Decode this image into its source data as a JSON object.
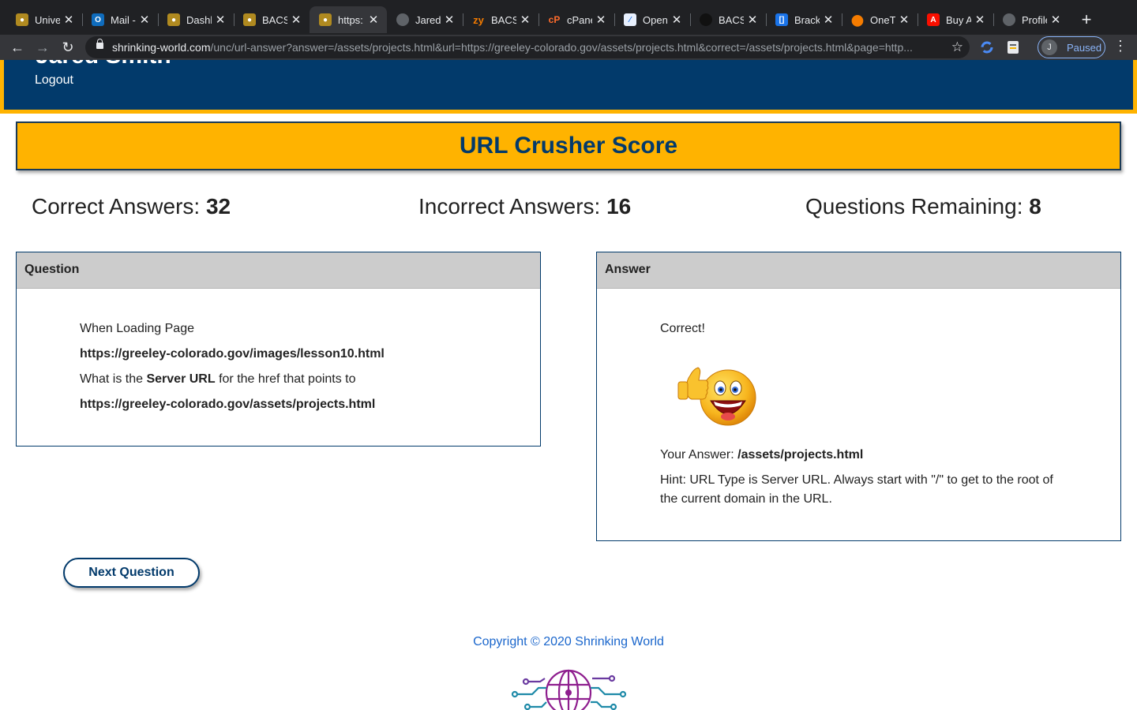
{
  "browser": {
    "tabs": [
      {
        "title": "University",
        "icon": "unc-bear-icon"
      },
      {
        "title": "Mail - ",
        "icon": "outlook-icon"
      },
      {
        "title": "Dashboard",
        "icon": "unc-bear-icon"
      },
      {
        "title": "BACS",
        "icon": "unc-bear-icon"
      },
      {
        "title": "https://",
        "icon": "unc-bear-icon",
        "active": true
      },
      {
        "title": "Jared",
        "icon": "globe-icon"
      },
      {
        "title": "BACS",
        "icon": "zybooks-icon"
      },
      {
        "title": "cPanel",
        "icon": "cpanel-icon"
      },
      {
        "title": "Open",
        "icon": "chart-icon"
      },
      {
        "title": "BACS",
        "icon": "github-icon"
      },
      {
        "title": "Brackets",
        "icon": "brackets-icon"
      },
      {
        "title": "OneTrust",
        "icon": "pin-icon"
      },
      {
        "title": "Buy Adobe",
        "icon": "adobe-icon"
      },
      {
        "title": "Profile",
        "icon": "globe-icon"
      }
    ],
    "url_domain": "shrinking-world.com",
    "url_path": "/unc/url-answer?answer=/assets/projects.html&url=https://greeley-colorado.gov/assets/projects.html&correct=/assets/projects.html&page=http...",
    "profile_initial": "J",
    "profile_status": "Paused"
  },
  "header": {
    "username": "Jared Smith",
    "logout": "Logout"
  },
  "banner": {
    "title": "URL Crusher Score"
  },
  "stats": {
    "correct_label": "Correct Answers: ",
    "correct_value": "32",
    "incorrect_label": "Incorrect Answers: ",
    "incorrect_value": "16",
    "remaining_label": "Questions Remaining: ",
    "remaining_value": "8"
  },
  "question": {
    "heading": "Question",
    "line1": "When Loading Page",
    "page_url": "https://greeley-colorado.gov/images/lesson10.html",
    "line3_pre": "What is the ",
    "line3_bold": "Server URL",
    "line3_post": " for the href that points to",
    "target_url": "https://greeley-colorado.gov/assets/projects.html"
  },
  "answer": {
    "heading": "Answer",
    "result": "Correct!",
    "your_answer_label": "Your Answer: ",
    "your_answer_value": "/assets/projects.html",
    "hint_line1": "Hint: URL Type is Server URL. Always start with \"/\" to get to the root of",
    "hint_line2": "the current domain in the URL."
  },
  "actions": {
    "next_label": "Next Question"
  },
  "footer": {
    "copyright": "Copyright © 2020 Shrinking World"
  }
}
